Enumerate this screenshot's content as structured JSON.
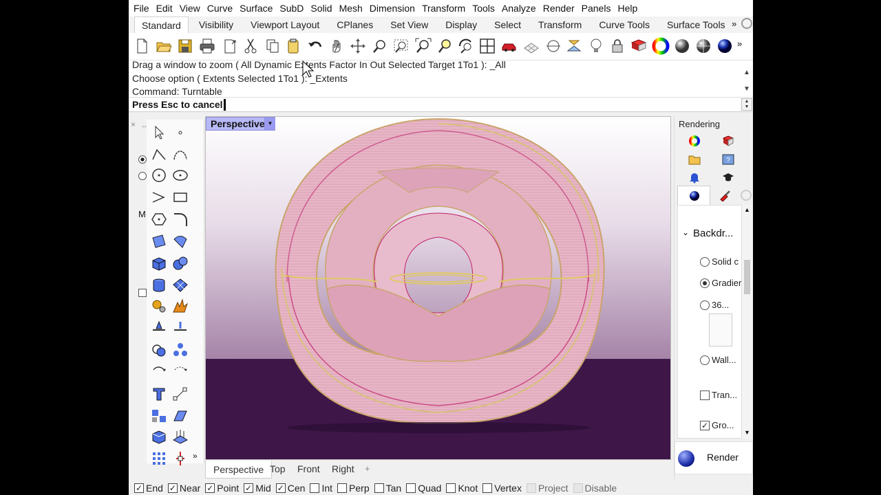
{
  "menu": [
    "File",
    "Edit",
    "View",
    "Curve",
    "Surface",
    "SubD",
    "Solid",
    "Mesh",
    "Dimension",
    "Transform",
    "Tools",
    "Analyze",
    "Render",
    "Panels",
    "Help"
  ],
  "tabs": [
    "Standard",
    "Visibility",
    "Viewport Layout",
    "CPlanes",
    "Set View",
    "Display",
    "Select",
    "Transform",
    "Curve Tools",
    "Surface Tools"
  ],
  "tabs_more": "»",
  "toolbar_more": "»",
  "toolbar_icons": [
    "new-icon",
    "open-icon",
    "save-icon",
    "print-icon",
    "import-icon",
    "cut-icon",
    "copy-icon",
    "paste-icon",
    "undo-icon",
    "pan-icon",
    "rotate-view-icon",
    "zoom-icon",
    "zoom-window-icon",
    "zoom-extents-icon",
    "zoom-selected-icon",
    "rotate-zoom-icon",
    "four-view-icon",
    "car-icon",
    "grid-icon",
    "osnap-icon",
    "cplane-icon",
    "lightbulb-icon",
    "lock-icon",
    "material-icon",
    "color-wheel-icon",
    "sphere-gray-icon",
    "sphere-shaded-icon",
    "sphere-blue-icon"
  ],
  "command": {
    "history": [
      "Drag a window to zoom ( All  Dynamic  Extents  Factor  In  Out  Selected  Target  1To1 ): _All",
      "Choose option ( Extents  Selected  1To1 ): _Extents",
      "Command: Turntable"
    ],
    "prompt": "Press Esc to cancel",
    "input_value": ""
  },
  "left_stub_label": "M",
  "left_stub_dots": "..",
  "left_toolbox_more": "»",
  "viewport": {
    "label": "Perspective",
    "colors": {
      "floor": "#3e1648",
      "bg_top": "#ffffff",
      "bg_bottom": "#a07aa0",
      "ribbon": "#e8b8c8",
      "ribbon_edge": "#c9a46a",
      "accent": "#c0206a"
    }
  },
  "viewport_tabs": [
    "Perspective",
    "Top",
    "Front",
    "Right"
  ],
  "viewport_tab_add": "+",
  "osnap": [
    {
      "label": "End",
      "checked": true,
      "disabled": false
    },
    {
      "label": "Near",
      "checked": true,
      "disabled": false
    },
    {
      "label": "Point",
      "checked": true,
      "disabled": false
    },
    {
      "label": "Mid",
      "checked": true,
      "disabled": false
    },
    {
      "label": "Cen",
      "checked": true,
      "disabled": false
    },
    {
      "label": "Int",
      "checked": false,
      "disabled": false
    },
    {
      "label": "Perp",
      "checked": false,
      "disabled": false
    },
    {
      "label": "Tan",
      "checked": false,
      "disabled": false
    },
    {
      "label": "Quad",
      "checked": false,
      "disabled": false
    },
    {
      "label": "Knot",
      "checked": false,
      "disabled": false
    },
    {
      "label": "Vertex",
      "checked": false,
      "disabled": false
    },
    {
      "label": "Project",
      "checked": false,
      "disabled": true
    },
    {
      "label": "Disable",
      "checked": false,
      "disabled": true
    }
  ],
  "right_panel": {
    "title": "Rendering",
    "section": "Backdr...",
    "options": [
      {
        "type": "radio",
        "label": "Solid c",
        "checked": false
      },
      {
        "type": "radio",
        "label": "Gradier",
        "checked": true
      },
      {
        "type": "radio",
        "label": "36...",
        "checked": false
      },
      {
        "type": "radio",
        "label": "Wall...",
        "checked": false
      },
      {
        "type": "check",
        "label": "Tran...",
        "checked": false
      },
      {
        "type": "check",
        "label": "Gro...",
        "checked": true
      }
    ],
    "render_button": "Render"
  }
}
